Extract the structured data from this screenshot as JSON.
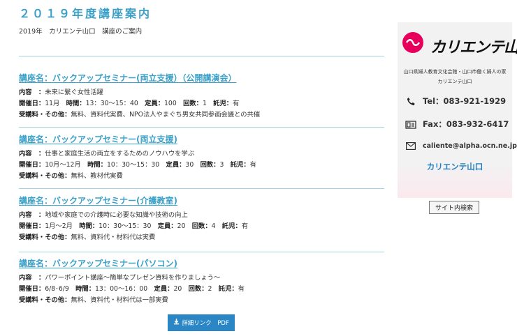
{
  "header": {
    "title": "２０１９年度講座案内",
    "subtitle": "2019年　カリエンテ山口　講座のご案内"
  },
  "courses": [
    {
      "title": "講座名：バックアップセミナー(両立支援）（公開講演会）",
      "content_label": "内容　：",
      "content": "未来に繋ぐ女性活躍",
      "schedule_label": "開催日：",
      "schedule": "11月",
      "time_label": "時間：",
      "time": "13：30〜15：40",
      "capacity_label": "定員：",
      "capacity": "100",
      "count_label": "回数：",
      "count": "1",
      "childcare_label": "託児：",
      "childcare": "有",
      "fee_label": "受講料・その他：",
      "fee": "無料、資料代実費、NPO法人やまぐち男女共同参画会議との共催"
    },
    {
      "title": "講座名：バックアップセミナー(両立支援)",
      "content_label": "内容　：",
      "content": "仕事と家庭生活の両立をするためのノウハウを学ぶ",
      "schedule_label": "開催日：",
      "schedule": "10月〜12月",
      "time_label": "時間：",
      "time": "10：30〜15：30",
      "capacity_label": "定員：",
      "capacity": "30",
      "count_label": "回数：",
      "count": "3",
      "childcare_label": "託児：",
      "childcare": "有",
      "fee_label": "受講料・その他：",
      "fee": "無料、教材代実費"
    },
    {
      "title": "講座名：バックアップセミナー(介護教室)",
      "content_label": "内容　：",
      "content": "地域や家庭での介護時に必要な知識や技術の向上",
      "schedule_label": "開催日：",
      "schedule": "1月〜2月",
      "time_label": "時間：",
      "time": "10：30〜15：30",
      "capacity_label": "定員：",
      "capacity": "20",
      "count_label": "回数：",
      "count": "4",
      "childcare_label": "託児：",
      "childcare": "有",
      "fee_label": "受講料・その他：",
      "fee": "無料、資料代・材料代は実費"
    },
    {
      "title": "講座名：バックアップセミナー(パソコン)",
      "content_label": "内容　：",
      "content": "パワーポイント講座〜簡単なプレゼン資料を作りましょう〜",
      "schedule_label": "開催日：",
      "schedule": "6/8･6/9",
      "time_label": "時間：",
      "time": "13：00〜16：00",
      "capacity_label": "定員：",
      "capacity": "20",
      "count_label": "回数：",
      "count": "2",
      "childcare_label": "託児：",
      "childcare": "有",
      "fee_label": "受講料・その他：",
      "fee": "無料、資料代・材料代は一部実費"
    }
  ],
  "pdf_button": {
    "label": "詳細リンク　PDF",
    "icon": "download-icon"
  },
  "sidebar": {
    "logo_text": "カリエンテ山口",
    "org_name_line1": "山口県婦人教育文化会館・山口市働く婦人の家",
    "org_name_line2": "カリエンテ山口",
    "tel": "Tel：083-921-1929",
    "fax": "Fax：083-932-6417",
    "email": "caliente@alpha.ocn.ne.jp",
    "brand_link": "カリエンテ山口",
    "search_button": "サイト内検索"
  },
  "colors": {
    "accent": "#3aa0c8",
    "button": "#2a86c4",
    "logo_red": "#e6005c",
    "brand_link": "#1f7fc0"
  }
}
